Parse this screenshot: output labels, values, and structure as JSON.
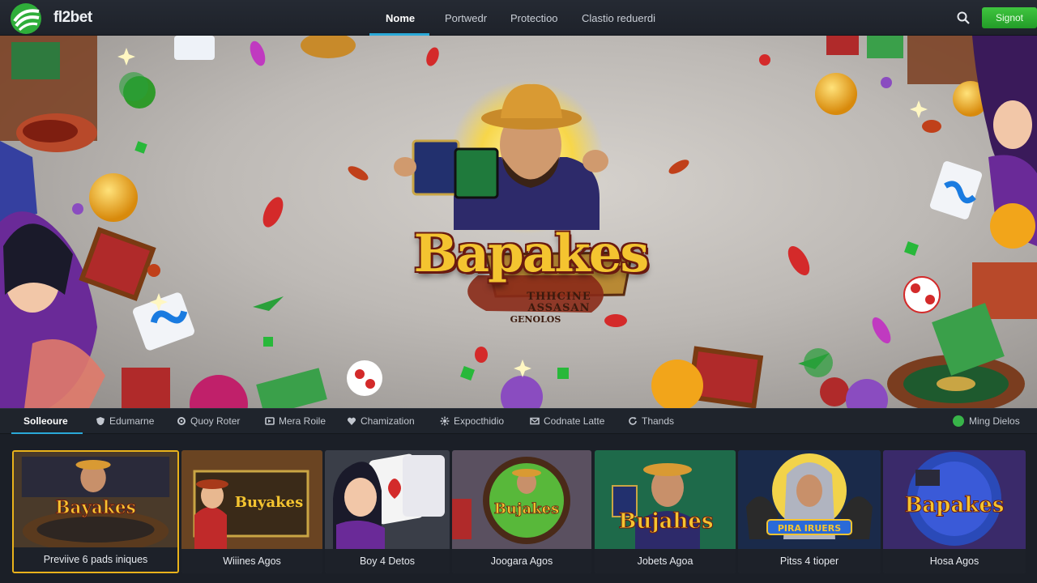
{
  "brand": {
    "name": "fl2bet"
  },
  "nav": {
    "links": [
      {
        "label": "Nome",
        "active": true
      },
      {
        "label": "Portwedr"
      },
      {
        "label": "Protectioo"
      },
      {
        "label": "Clastio reduerdi"
      }
    ],
    "signup_label": "Signot"
  },
  "hero": {
    "title": "Bapakes",
    "subtitle_line1": "THHCINE",
    "subtitle_line2": "ASSASAN",
    "subtitle_line3": "GENOLOS"
  },
  "categories": {
    "items": [
      {
        "label": "Solleoure",
        "icon": "none",
        "active": true
      },
      {
        "label": "Edumarne",
        "icon": "shield-icon"
      },
      {
        "label": "Quoy Roter",
        "icon": "gear-icon"
      },
      {
        "label": "Mera Roile",
        "icon": "tv-icon"
      },
      {
        "label": "Chamization",
        "icon": "heart-icon"
      },
      {
        "label": "Expocthidio",
        "icon": "settings-icon"
      },
      {
        "label": "Codnate Latte",
        "icon": "mail-icon"
      },
      {
        "label": "Thands",
        "icon": "refresh-icon"
      }
    ],
    "right_label": "Ming Dielos"
  },
  "games": [
    {
      "label": "Previive 6 pads iniques",
      "art_title": "Bayakes",
      "selected": true
    },
    {
      "label": "Wiiines Agos",
      "art_title": "Buyakes"
    },
    {
      "label": "Boy 4 Detos",
      "art_title": ""
    },
    {
      "label": "Joogara Agos",
      "art_title": "Bujakes"
    },
    {
      "label": "Jobets Agoa",
      "art_title": "Bujahes"
    },
    {
      "label": "Pitss 4 tioper",
      "art_title": "PIRA IRUERS"
    },
    {
      "label": "Hosa Agos",
      "art_title": "Bapakes"
    }
  ],
  "colors": {
    "accent": "#2aa9d8",
    "signup": "#2fb134",
    "selected_border": "#e9b21b",
    "title_gold": "#f4c430"
  }
}
